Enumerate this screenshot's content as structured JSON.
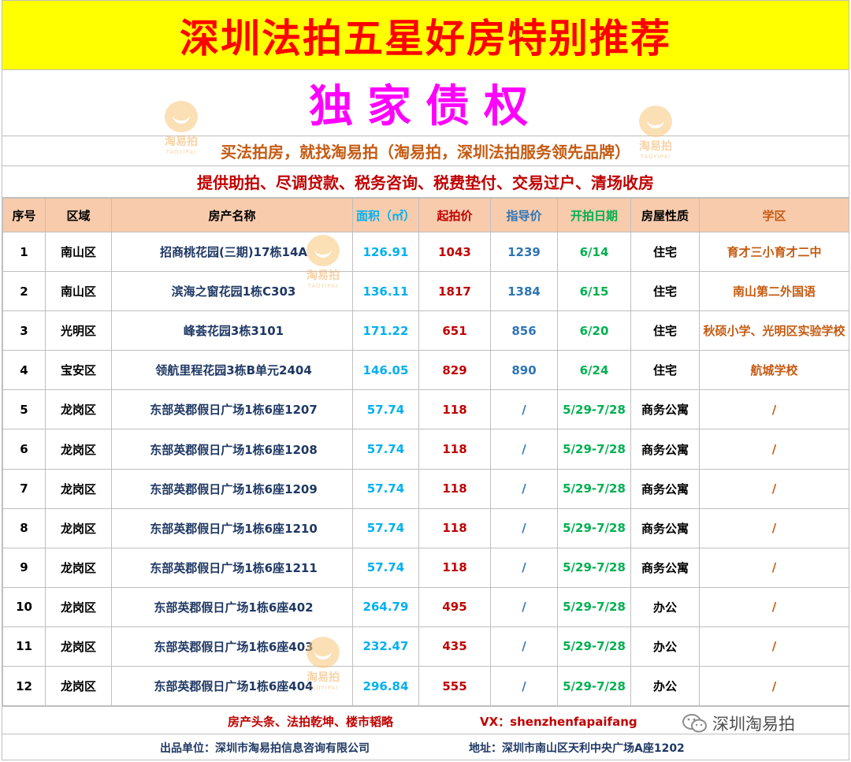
{
  "title": "深圳法拍五星好房特别推荐",
  "subtitle": "独家债权",
  "slogan": "买法拍房，就找淘易拍（淘易拍，深圳法拍服务领先品牌）",
  "services": "提供助拍、尽调贷款、税务咨询、税费垫付、交易过户、清场收房",
  "watermark": {
    "cn": "淘易拍",
    "en": "TAOYIPAI"
  },
  "table": {
    "headers": [
      "序号",
      "区域",
      "房产名称",
      "面积（㎡）",
      "起拍价",
      "指导价",
      "开拍日期",
      "房屋性质",
      "学区"
    ],
    "rows": [
      {
        "no": "1",
        "district": "南山区",
        "name": "招商桃花园(三期)17栋14A",
        "area": "126.91",
        "start": "1043",
        "guide": "1239",
        "date": "6/14",
        "type": "住宅",
        "school": "育才三小育才二中"
      },
      {
        "no": "2",
        "district": "南山区",
        "name": "滨海之窗花园1栋C303",
        "area": "136.11",
        "start": "1817",
        "guide": "1384",
        "date": "6/15",
        "type": "住宅",
        "school": "南山第二外国语"
      },
      {
        "no": "3",
        "district": "光明区",
        "name": "峰荟花园3栋3101",
        "area": "171.22",
        "start": "651",
        "guide": "856",
        "date": "6/20",
        "type": "住宅",
        "school": "秋硕小学、光明区实验学校"
      },
      {
        "no": "4",
        "district": "宝安区",
        "name": "领航里程花园3栋B单元2404",
        "area": "146.05",
        "start": "829",
        "guide": "890",
        "date": "6/24",
        "type": "住宅",
        "school": "航城学校"
      },
      {
        "no": "5",
        "district": "龙岗区",
        "name": "东部英郡假日广场1栋6座1207",
        "area": "57.74",
        "start": "118",
        "guide": "/",
        "date": "5/29-7/28",
        "type": "商务公寓",
        "school": "/"
      },
      {
        "no": "6",
        "district": "龙岗区",
        "name": "东部英郡假日广场1栋6座1208",
        "area": "57.74",
        "start": "118",
        "guide": "/",
        "date": "5/29-7/28",
        "type": "商务公寓",
        "school": "/"
      },
      {
        "no": "7",
        "district": "龙岗区",
        "name": "东部英郡假日广场1栋6座1209",
        "area": "57.74",
        "start": "118",
        "guide": "/",
        "date": "5/29-7/28",
        "type": "商务公寓",
        "school": "/"
      },
      {
        "no": "8",
        "district": "龙岗区",
        "name": "东部英郡假日广场1栋6座1210",
        "area": "57.74",
        "start": "118",
        "guide": "/",
        "date": "5/29-7/28",
        "type": "商务公寓",
        "school": "/"
      },
      {
        "no": "9",
        "district": "龙岗区",
        "name": "东部英郡假日广场1栋6座1211",
        "area": "57.74",
        "start": "118",
        "guide": "/",
        "date": "5/29-7/28",
        "type": "商务公寓",
        "school": "/"
      },
      {
        "no": "10",
        "district": "龙岗区",
        "name": "东部英郡假日广场1栋6座402",
        "area": "264.79",
        "start": "495",
        "guide": "/",
        "date": "5/29-7/28",
        "type": "办公",
        "school": "/"
      },
      {
        "no": "11",
        "district": "龙岗区",
        "name": "东部英郡假日广场1栋6座403",
        "area": "232.47",
        "start": "435",
        "guide": "/",
        "date": "5/29-7/28",
        "type": "办公",
        "school": "/"
      },
      {
        "no": "12",
        "district": "龙岗区",
        "name": "东部英郡假日广场1栋6座404",
        "area": "296.84",
        "start": "555",
        "guide": "/",
        "date": "5/29-7/28",
        "type": "办公",
        "school": "/"
      }
    ]
  },
  "footer": {
    "media": "房产头条、法拍乾坤、楼市韬略",
    "vx": "VX：shenzhenfapaifang",
    "producer": "出品单位：深圳市淘易拍信息咨询有限公司",
    "address": "地址：深圳市南山区天利中央广场A座1202"
  },
  "wechat_account": "深圳淘易拍",
  "colors": {
    "title_bg": "#ffff00",
    "title_text": "#ff0000",
    "subtitle_text": "#ff00ff",
    "header_bg": "#f8cbad",
    "area": "#00b0f0",
    "start": "#c00000",
    "guide": "#2e75b6",
    "date": "#00b050",
    "school": "#c55a11"
  }
}
